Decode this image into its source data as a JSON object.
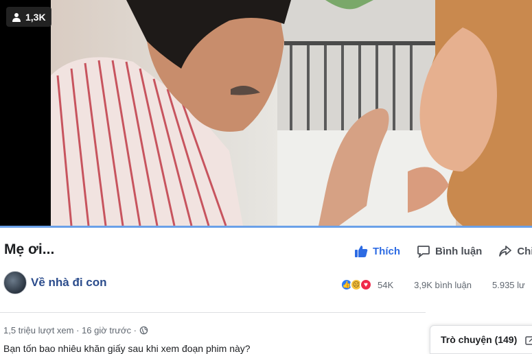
{
  "video": {
    "viewer_count": "1,3K"
  },
  "post": {
    "title": "Mẹ ơi...",
    "page_name": "Về nhà đi con",
    "views_time": "1,5 triệu lượt xem · 16 giờ trước ·",
    "description": "Bạn tốn bao nhiêu khăn giấy sau khi xem đoạn phim này?"
  },
  "actions": {
    "like_label": "Thích",
    "comment_label": "Bình luận",
    "share_label": "Chia"
  },
  "stats": {
    "reaction_count": "54K",
    "comment_count": "3,9K bình luận",
    "share_count": "5.935 lư"
  },
  "chat": {
    "label": "Trò chuyện (149)"
  },
  "colors": {
    "accent": "#2d6be3",
    "page_link": "#2b4c8c",
    "progress": "#6aa0e8"
  }
}
